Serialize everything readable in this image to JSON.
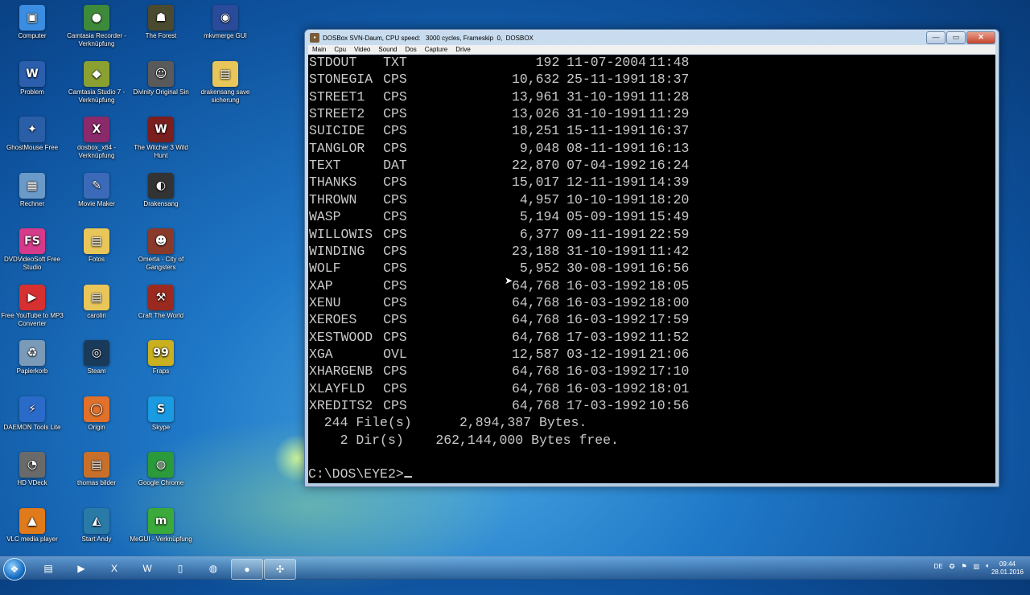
{
  "colors": {
    "console_bg": "#000000",
    "console_fg": "#c8c8c8",
    "desktop_blue": "#1f78c7"
  },
  "desktop_icons": [
    {
      "label": "Computer",
      "icon": "computer-icon",
      "glyph": "▣",
      "bg": "#3a8de0"
    },
    {
      "label": "Camtasia Recorder - Verknüpfung",
      "icon": "camtasia-recorder-icon",
      "glyph": "●",
      "bg": "#3d8a3a"
    },
    {
      "label": "The Forest",
      "icon": "the-forest-icon",
      "glyph": "☗",
      "bg": "#4a4a30"
    },
    {
      "label": "mkvmerge GUI",
      "icon": "mkvmerge-icon",
      "glyph": "◉",
      "bg": "#2a4a9a"
    },
    {
      "label": "Problem",
      "icon": "word-document-icon",
      "glyph": "W",
      "bg": "#2b5fae"
    },
    {
      "label": "Camtasia Studio 7 - Verknüpfung",
      "icon": "camtasia-studio-icon",
      "glyph": "◆",
      "bg": "#8aa030"
    },
    {
      "label": "Divinity Original Sin",
      "icon": "divinity-icon",
      "glyph": "☺",
      "bg": "#5a5a5a"
    },
    {
      "label": "drakensang save sicherung",
      "icon": "folder-icon",
      "glyph": "▤",
      "bg": "#e8c65a"
    },
    {
      "label": "GhostMouse Free",
      "icon": "ghostmouse-icon",
      "glyph": "✦",
      "bg": "#2a5fa8"
    },
    {
      "label": "dosbox_x64 - Verknüpfung",
      "icon": "dosbox-icon",
      "glyph": "X",
      "bg": "#8a2a6a"
    },
    {
      "label": "The Witcher 3 Wild Hunt",
      "icon": "witcher-icon",
      "glyph": "W",
      "bg": "#7a1e1e"
    },
    {
      "label": "Rechner",
      "icon": "calculator-icon",
      "glyph": "▦",
      "bg": "#6a9ac8"
    },
    {
      "label": "Movie Maker",
      "icon": "movie-maker-icon",
      "glyph": "✎",
      "bg": "#3a6ab8"
    },
    {
      "label": "Drakensang",
      "icon": "drakensang-icon",
      "glyph": "◐",
      "bg": "#333333"
    },
    {
      "label": "DVDVideoSoft Free Studio",
      "icon": "dvdvideosoft-icon",
      "glyph": "FS",
      "bg": "#d63a8a"
    },
    {
      "label": "Fotos",
      "icon": "folder-icon",
      "glyph": "▤",
      "bg": "#e8c65a"
    },
    {
      "label": "Omerta - City of Gangsters",
      "icon": "omerta-icon",
      "glyph": "☻",
      "bg": "#8a3a2a"
    },
    {
      "label": "Free YouTube to MP3 Converter",
      "icon": "youtube-mp3-icon",
      "glyph": "▶",
      "bg": "#d63030"
    },
    {
      "label": "carolin",
      "icon": "folder-icon",
      "glyph": "▤",
      "bg": "#e8c65a"
    },
    {
      "label": "Craft The World",
      "icon": "craft-the-world-icon",
      "glyph": "⚒",
      "bg": "#9a2a20"
    },
    {
      "label": "Papierkorb",
      "icon": "recycle-bin-icon",
      "glyph": "♻",
      "bg": "#7a9ab8"
    },
    {
      "label": "Steam",
      "icon": "steam-icon",
      "glyph": "◎",
      "bg": "#1a3a5a"
    },
    {
      "label": "Fraps",
      "icon": "fraps-icon",
      "glyph": "99",
      "bg": "#c8b020"
    },
    {
      "label": "DAEMON Tools Lite",
      "icon": "daemon-tools-icon",
      "glyph": "⚡",
      "bg": "#2a6ac8"
    },
    {
      "label": "Origin",
      "icon": "origin-icon",
      "glyph": "◯",
      "bg": "#e0702a"
    },
    {
      "label": "Skype",
      "icon": "skype-icon",
      "glyph": "S",
      "bg": "#1a9ae0"
    },
    {
      "label": "HD VDeck",
      "icon": "hd-vdeck-icon",
      "glyph": "◔",
      "bg": "#6a6a6a"
    },
    {
      "label": "thomas bilder",
      "icon": "folder-icon",
      "glyph": "▤",
      "bg": "#c8702a"
    },
    {
      "label": "Google Chrome",
      "icon": "chrome-icon",
      "glyph": "◍",
      "bg": "#2a9a3a"
    },
    {
      "label": "VLC media player",
      "icon": "vlc-icon",
      "glyph": "▲",
      "bg": "#e07a1a"
    },
    {
      "label": "Start Andy",
      "icon": "start-andy-icon",
      "glyph": "◭",
      "bg": "#2a7aa8"
    },
    {
      "label": "MeGUI - Verknüpfung",
      "icon": "megui-icon",
      "glyph": "m",
      "bg": "#3aaa3a"
    }
  ],
  "window": {
    "title_prefix": "DOSBox SVN-Daum, CPU speed:",
    "title_cycles": "3000 cycles, Frameskip  0,",
    "title_program": "DOSBOX",
    "min_label": "—",
    "max_label": "▭",
    "close_label": "✕",
    "menu": [
      "Main",
      "Cpu",
      "Video",
      "Sound",
      "Dos",
      "Capture",
      "Drive"
    ]
  },
  "console": {
    "files": [
      {
        "name": "STDOUT",
        "ext": "TXT",
        "size": "192",
        "date": "11-07-2004",
        "time": "11:48"
      },
      {
        "name": "STONEGIA",
        "ext": "CPS",
        "size": "10,632",
        "date": "25-11-1991",
        "time": "18:37"
      },
      {
        "name": "STREET1",
        "ext": "CPS",
        "size": "13,961",
        "date": "31-10-1991",
        "time": "11:28"
      },
      {
        "name": "STREET2",
        "ext": "CPS",
        "size": "13,026",
        "date": "31-10-1991",
        "time": "11:29"
      },
      {
        "name": "SUICIDE",
        "ext": "CPS",
        "size": "18,251",
        "date": "15-11-1991",
        "time": "16:37"
      },
      {
        "name": "TANGLOR",
        "ext": "CPS",
        "size": "9,048",
        "date": "08-11-1991",
        "time": "16:13"
      },
      {
        "name": "TEXT",
        "ext": "DAT",
        "size": "22,870",
        "date": "07-04-1992",
        "time": "16:24"
      },
      {
        "name": "THANKS",
        "ext": "CPS",
        "size": "15,017",
        "date": "12-11-1991",
        "time": "14:39"
      },
      {
        "name": "THROWN",
        "ext": "CPS",
        "size": "4,957",
        "date": "10-10-1991",
        "time": "18:20"
      },
      {
        "name": "WASP",
        "ext": "CPS",
        "size": "5,194",
        "date": "05-09-1991",
        "time": "15:49"
      },
      {
        "name": "WILLOWIS",
        "ext": "CPS",
        "size": "6,377",
        "date": "09-11-1991",
        "time": "22:59"
      },
      {
        "name": "WINDING",
        "ext": "CPS",
        "size": "23,188",
        "date": "31-10-1991",
        "time": "11:42"
      },
      {
        "name": "WOLF",
        "ext": "CPS",
        "size": "5,952",
        "date": "30-08-1991",
        "time": "16:56"
      },
      {
        "name": "XAP",
        "ext": "CPS",
        "size": "64,768",
        "date": "16-03-1992",
        "time": "18:05"
      },
      {
        "name": "XENU",
        "ext": "CPS",
        "size": "64,768",
        "date": "16-03-1992",
        "time": "18:00"
      },
      {
        "name": "XEROES",
        "ext": "CPS",
        "size": "64,768",
        "date": "16-03-1992",
        "time": "17:59"
      },
      {
        "name": "XESTWOOD",
        "ext": "CPS",
        "size": "64,768",
        "date": "17-03-1992",
        "time": "11:52"
      },
      {
        "name": "XGA",
        "ext": "OVL",
        "size": "12,587",
        "date": "03-12-1991",
        "time": "21:06"
      },
      {
        "name": "XHARGENB",
        "ext": "CPS",
        "size": "64,768",
        "date": "16-03-1992",
        "time": "17:10"
      },
      {
        "name": "XLAYFLD",
        "ext": "CPS",
        "size": "64,768",
        "date": "16-03-1992",
        "time": "18:01"
      },
      {
        "name": "XREDITS2",
        "ext": "CPS",
        "size": "64,768",
        "date": "17-03-1992",
        "time": "10:56"
      }
    ],
    "summary_files": "  244 File(s)      2,894,387 Bytes.",
    "summary_dirs": "    2 Dir(s)    262,144,000 Bytes free.",
    "prompt": "C:\\DOS\\EYE2>"
  },
  "taskbar": {
    "start_icon": "windows-start-icon",
    "pinned": [
      {
        "icon": "explorer-icon",
        "glyph": "▤",
        "active": false
      },
      {
        "icon": "media-player-icon",
        "glyph": "▶",
        "active": false
      },
      {
        "icon": "excel-icon",
        "glyph": "X",
        "active": false
      },
      {
        "icon": "word-icon",
        "glyph": "W",
        "active": false
      },
      {
        "icon": "notepad-icon",
        "glyph": "▯",
        "active": false
      },
      {
        "icon": "chrome-icon",
        "glyph": "◍",
        "active": false
      },
      {
        "icon": "camtasia-icon",
        "glyph": "●",
        "active": true
      },
      {
        "icon": "dosbox-icon",
        "glyph": "✣",
        "active": true
      }
    ],
    "language": "DE",
    "time": "09:44",
    "date": "28.01.2016"
  }
}
